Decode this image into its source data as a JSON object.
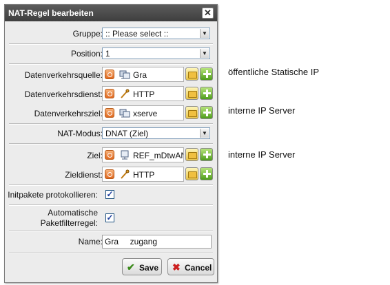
{
  "dialog": {
    "title": "NAT-Regel bearbeiten",
    "close_glyph": "✕",
    "fields": {
      "gruppe": {
        "label": "Gruppe:",
        "value": ":: Please select ::"
      },
      "position": {
        "label": "Position:",
        "value": "1"
      },
      "datenverkehrsquelle": {
        "label": "Datenverkehrsquelle:",
        "value": "Gra",
        "icon": "network-host-icon"
      },
      "datenverkehrsdienst": {
        "label": "Datenverkehrsdienst:",
        "value": "HTTP",
        "icon": "service-icon"
      },
      "datenverkehrsziel": {
        "label": "Datenverkehrsziel:",
        "value": "xserve",
        "icon": "network-host-icon"
      },
      "nat_modus": {
        "label": "NAT-Modus:",
        "value": "DNAT (Ziel)"
      },
      "ziel": {
        "label": "Ziel:",
        "value": "REF_mDtwAN",
        "icon": "host-icon"
      },
      "zieldienst": {
        "label": "Zieldienst:",
        "value": "HTTP",
        "icon": "service-icon"
      },
      "initpakete": {
        "label": "Initpakete protokollieren:",
        "checked": true
      },
      "auto_filter": {
        "label_line1": "Automatische",
        "label_line2": "Paketfilterregel:",
        "checked": true
      },
      "name": {
        "label": "Name:",
        "value": "Gra     zugang"
      }
    },
    "buttons": {
      "save": "Save",
      "cancel": "Cancel"
    }
  },
  "annotations": {
    "quelle_note": "öffentliche  Statische IP",
    "ziel_note": "interne IP Server",
    "ziel2_note": "interne IP Server"
  },
  "colors": {
    "titlebar": "#4a4a4a",
    "dialog_bg": "#ececec",
    "add_green": "#5aa823",
    "remove_orange": "#e8742a",
    "cancel_red": "#cc1f1f",
    "save_green": "#3a8a1a"
  }
}
